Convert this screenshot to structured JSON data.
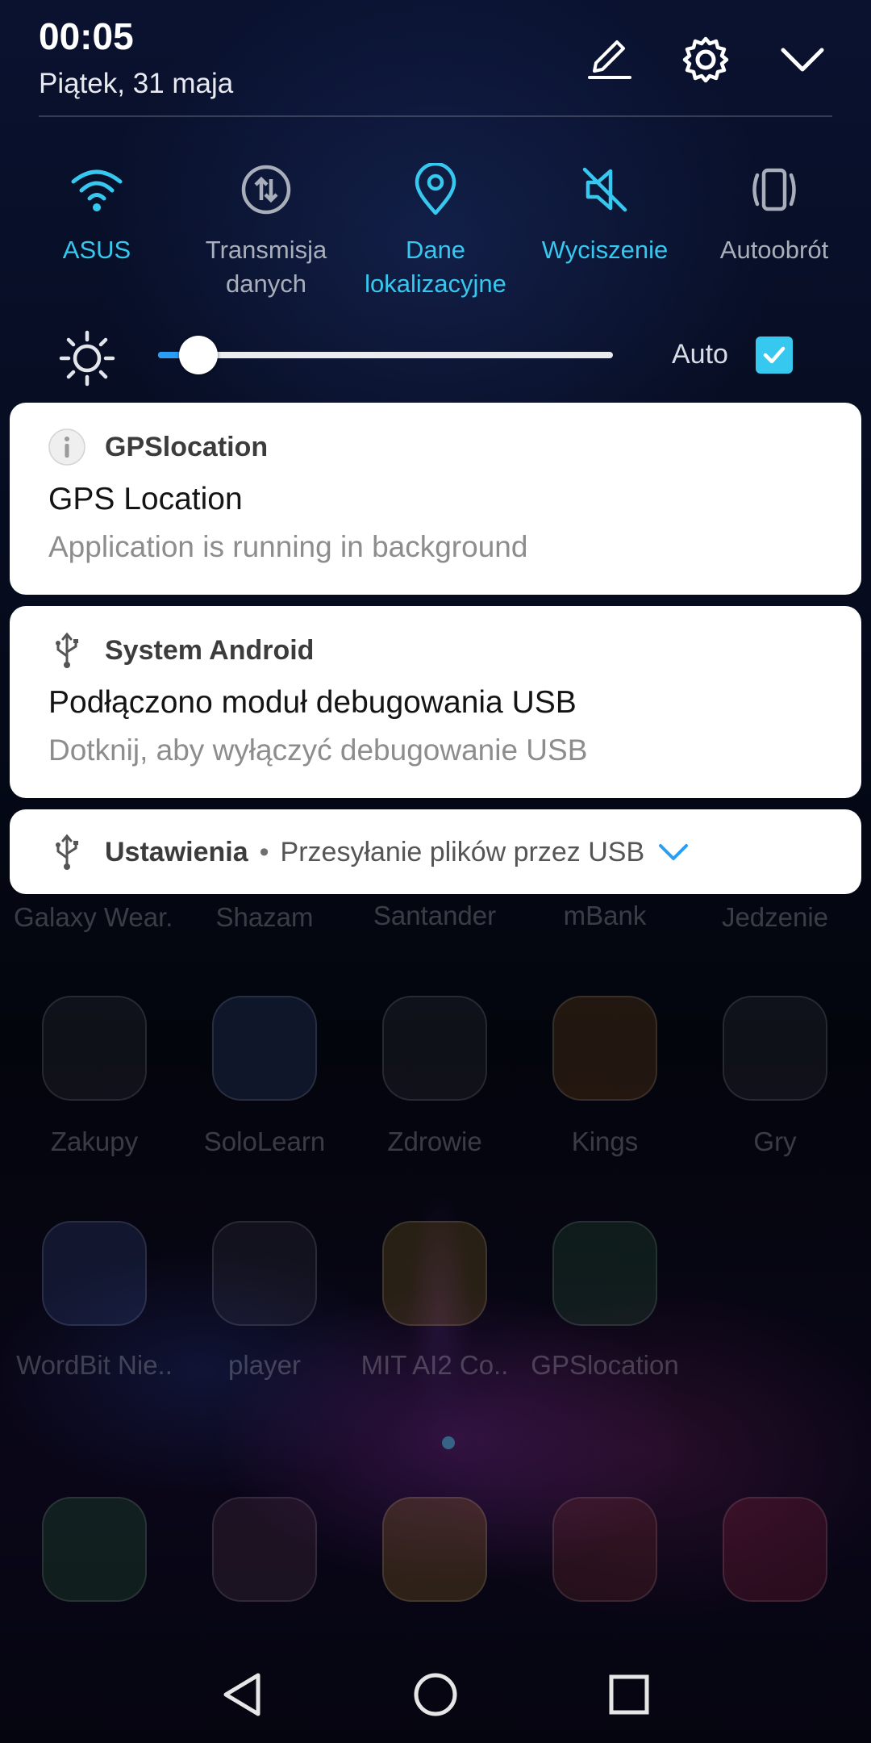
{
  "status": {
    "time": "00:05",
    "date": "Piątek, 31 maja"
  },
  "header_icons": [
    "edit-icon",
    "settings-gear-icon",
    "collapse-chevron-icon"
  ],
  "toggles": [
    {
      "icon": "wifi-icon",
      "label": "ASUS",
      "active": true
    },
    {
      "icon": "data-transfer-icon",
      "label": "Transmisja danych",
      "active": false
    },
    {
      "icon": "location-pin-icon",
      "label": "Dane lokalizacyjne",
      "active": true
    },
    {
      "icon": "muted-icon",
      "label": "Wyciszenie",
      "active": true
    },
    {
      "icon": "auto-rotate-icon",
      "label": "Autoobrót",
      "active": false
    }
  ],
  "brightness": {
    "level": 0.05,
    "auto_label": "Auto",
    "auto_enabled": true
  },
  "notifications": [
    {
      "app": "GPSlocation",
      "icon": "info-icon",
      "title": "GPS Location",
      "text": "Application is running in background"
    },
    {
      "app": "System Android",
      "icon": "usb-icon",
      "title": "Podłączono moduł debugowania USB",
      "text": "Dotknij, aby wyłączyć debugowanie USB"
    },
    {
      "app": "Ustawienia",
      "icon": "usb-icon",
      "separator": "•",
      "summary": "Przesyłanie plików przez USB"
    }
  ],
  "home_screen": {
    "row1": [
      "Galaxy Wear..",
      "Shazam",
      "Santander",
      "mBank",
      "Jedzenie"
    ],
    "row2": [
      "Zakupy",
      "SoloLearn",
      "Zdrowie",
      "Kings",
      "Gry"
    ],
    "row3": [
      "WordBit Nie..",
      "player",
      "MIT AI2 Co..",
      "GPSlocation"
    ]
  },
  "nav": [
    "back-icon",
    "home-icon",
    "recents-icon"
  ],
  "colors": {
    "accent": "#37c8f0",
    "inactive": "#a9afba",
    "slider_fill": "#2a9df4",
    "card_bg": "#ffffff"
  }
}
